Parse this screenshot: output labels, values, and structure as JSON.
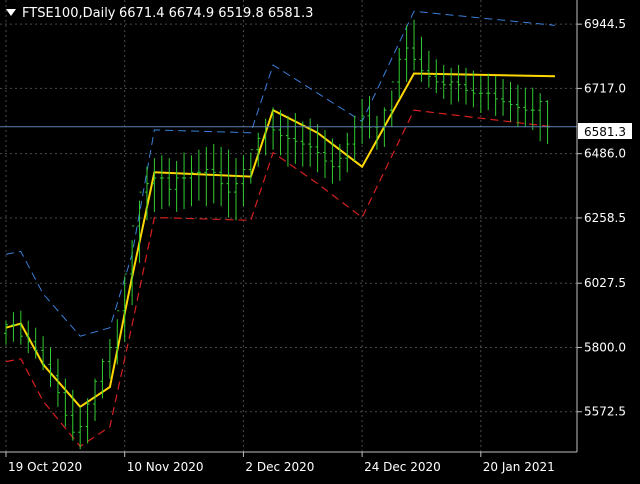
{
  "header": {
    "symbol": "FTSE100,Daily",
    "ohlc": "6671.4 6674.9 6519.8 6581.3"
  },
  "current_price_label": "6581.3",
  "colors": {
    "background": "#000000",
    "grid": "#4a4a4a",
    "axis": "#c0c0c0",
    "text": "#ffffff",
    "bar": "#32cd32",
    "middle_band": "#ffd700",
    "upper_band": "#3a7fd9",
    "lower_band": "#d62020",
    "price_line": "#5b7fb0"
  },
  "chart_data": {
    "type": "line",
    "price_axis_ticks": [
      "6944.5",
      "6717.0",
      "6486.0",
      "6258.5",
      "6027.5",
      "5800.0",
      "5572.5"
    ],
    "price_axis_values": [
      6944.5,
      6717.0,
      6486.0,
      6258.5,
      6027.5,
      5800.0,
      5572.5
    ],
    "ylim": [
      5430,
      7030
    ],
    "time_axis_labels": [
      "19 Oct 2020",
      "10 Nov 2020",
      "2 Dec 2020",
      "24 Dec 2020",
      "20 Jan 2021"
    ],
    "time_axis_index": [
      0,
      16,
      32,
      48,
      64
    ],
    "xlim": [
      0,
      74
    ],
    "current_price": 6581.3,
    "grid": true,
    "series": [
      {
        "name": "",
        "role": "upper",
        "x": [
          0,
          2,
          5,
          10,
          14,
          17,
          20,
          33,
          36,
          42,
          48,
          55,
          74
        ],
        "y": [
          6130,
          6140,
          5990,
          5840,
          5870,
          6130,
          6570,
          6560,
          6800,
          6700,
          6600,
          6990,
          6940
        ]
      },
      {
        "name": "",
        "role": "middle",
        "x": [
          0,
          2,
          5,
          10,
          14,
          17,
          20,
          33,
          36,
          42,
          48,
          55,
          74
        ],
        "y": [
          5870,
          5885,
          5740,
          5590,
          5660,
          6050,
          6420,
          6405,
          6640,
          6560,
          6440,
          6770,
          6760
        ]
      },
      {
        "name": "",
        "role": "lower",
        "x": [
          0,
          2,
          5,
          10,
          14,
          17,
          20,
          33,
          36,
          42,
          48,
          55,
          74
        ],
        "y": [
          5750,
          5760,
          5610,
          5450,
          5520,
          5880,
          6260,
          6250,
          6490,
          6380,
          6260,
          6640,
          6580
        ]
      }
    ],
    "bars": {
      "x": [
        0,
        1,
        2,
        3,
        4,
        5,
        6,
        7,
        8,
        9,
        10,
        11,
        12,
        13,
        14,
        15,
        16,
        17,
        18,
        19,
        20,
        21,
        22,
        23,
        24,
        25,
        26,
        27,
        28,
        29,
        30,
        31,
        32,
        33,
        34,
        35,
        36,
        37,
        38,
        39,
        40,
        41,
        42,
        43,
        44,
        45,
        46,
        47,
        48,
        49,
        50,
        51,
        52,
        53,
        54,
        55,
        56,
        57,
        58,
        59,
        60,
        61,
        62,
        63,
        64,
        65,
        66,
        67,
        68,
        69,
        70,
        71,
        72,
        73
      ],
      "high": [
        5895,
        5925,
        5930,
        5895,
        5870,
        5840,
        5800,
        5760,
        5690,
        5650,
        5590,
        5620,
        5690,
        5760,
        5830,
        5900,
        6050,
        6180,
        6320,
        6440,
        6470,
        6480,
        6470,
        6460,
        6490,
        6480,
        6500,
        6510,
        6520,
        6510,
        6500,
        6470,
        6480,
        6490,
        6560,
        6610,
        6650,
        6640,
        6620,
        6630,
        6600,
        6610,
        6590,
        6570,
        6540,
        6520,
        6560,
        6620,
        6680,
        6690,
        6620,
        6650,
        6710,
        6860,
        6940,
        6960,
        6900,
        6850,
        6820,
        6800,
        6790,
        6800,
        6790,
        6780,
        6760,
        6770,
        6760,
        6750,
        6740,
        6730,
        6720,
        6720,
        6700,
        6675
      ],
      "low": [
        5810,
        5820,
        5810,
        5780,
        5760,
        5720,
        5660,
        5590,
        5520,
        5470,
        5440,
        5460,
        5540,
        5620,
        5690,
        5740,
        5820,
        5950,
        6100,
        6250,
        6280,
        6290,
        6300,
        6280,
        6290,
        6300,
        6320,
        6300,
        6310,
        6300,
        6260,
        6250,
        6300,
        6380,
        6440,
        6480,
        6500,
        6480,
        6440,
        6450,
        6440,
        6440,
        6420,
        6400,
        6380,
        6390,
        6420,
        6460,
        6520,
        6540,
        6500,
        6510,
        6580,
        6680,
        6740,
        6780,
        6740,
        6720,
        6700,
        6680,
        6660,
        6670,
        6660,
        6650,
        6630,
        6640,
        6620,
        6620,
        6600,
        6580,
        6580,
        6570,
        6530,
        6520
      ],
      "open": [
        5850,
        5880,
        5880,
        5840,
        5820,
        5790,
        5740,
        5700,
        5640,
        5560,
        5500,
        5520,
        5600,
        5680,
        5750,
        5800,
        5930,
        6060,
        6230,
        6350,
        6380,
        6400,
        6400,
        6360,
        6400,
        6400,
        6420,
        6420,
        6430,
        6420,
        6380,
        6350,
        6380,
        6430,
        6500,
        6540,
        6580,
        6570,
        6550,
        6540,
        6530,
        6520,
        6510,
        6490,
        6460,
        6440,
        6470,
        6520,
        6580,
        6620,
        6580,
        6580,
        6640,
        6740,
        6820,
        6860,
        6820,
        6780,
        6760,
        6740,
        6730,
        6740,
        6730,
        6710,
        6700,
        6700,
        6700,
        6680,
        6670,
        6660,
        6650,
        6640,
        6640,
        6671
      ],
      "close": [
        5880,
        5880,
        5840,
        5820,
        5790,
        5740,
        5700,
        5640,
        5560,
        5500,
        5520,
        5600,
        5680,
        5750,
        5800,
        5930,
        6060,
        6230,
        6350,
        6380,
        6400,
        6400,
        6360,
        6400,
        6400,
        6420,
        6420,
        6430,
        6420,
        6380,
        6350,
        6380,
        6430,
        6500,
        6540,
        6580,
        6570,
        6550,
        6540,
        6530,
        6520,
        6510,
        6490,
        6460,
        6440,
        6470,
        6520,
        6580,
        6620,
        6580,
        6580,
        6640,
        6740,
        6820,
        6860,
        6820,
        6780,
        6760,
        6740,
        6730,
        6740,
        6730,
        6710,
        6700,
        6700,
        6700,
        6680,
        6670,
        6660,
        6650,
        6640,
        6640,
        6671,
        6581
      ]
    }
  }
}
